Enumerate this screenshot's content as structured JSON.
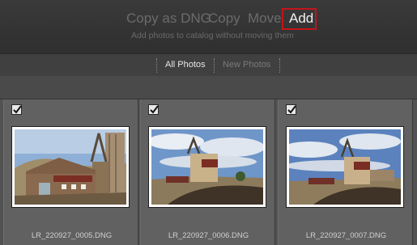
{
  "modes": {
    "copy_dng": "Copy as DNG",
    "copy": "Copy",
    "move": "Move",
    "add": "Add",
    "subtitle": "Add photos to catalog without moving them",
    "selected": "Add"
  },
  "tabs": {
    "all_photos": "All Photos",
    "new_photos": "New Photos",
    "active": "All Photos"
  },
  "photos": [
    {
      "filename": "LR_220927_0005.DNG",
      "checked": true
    },
    {
      "filename": "LR_220927_0006.DNG",
      "checked": true
    },
    {
      "filename": "LR_220927_0007.DNG",
      "checked": true
    }
  ],
  "colors": {
    "highlight_box": "#c4141a"
  }
}
